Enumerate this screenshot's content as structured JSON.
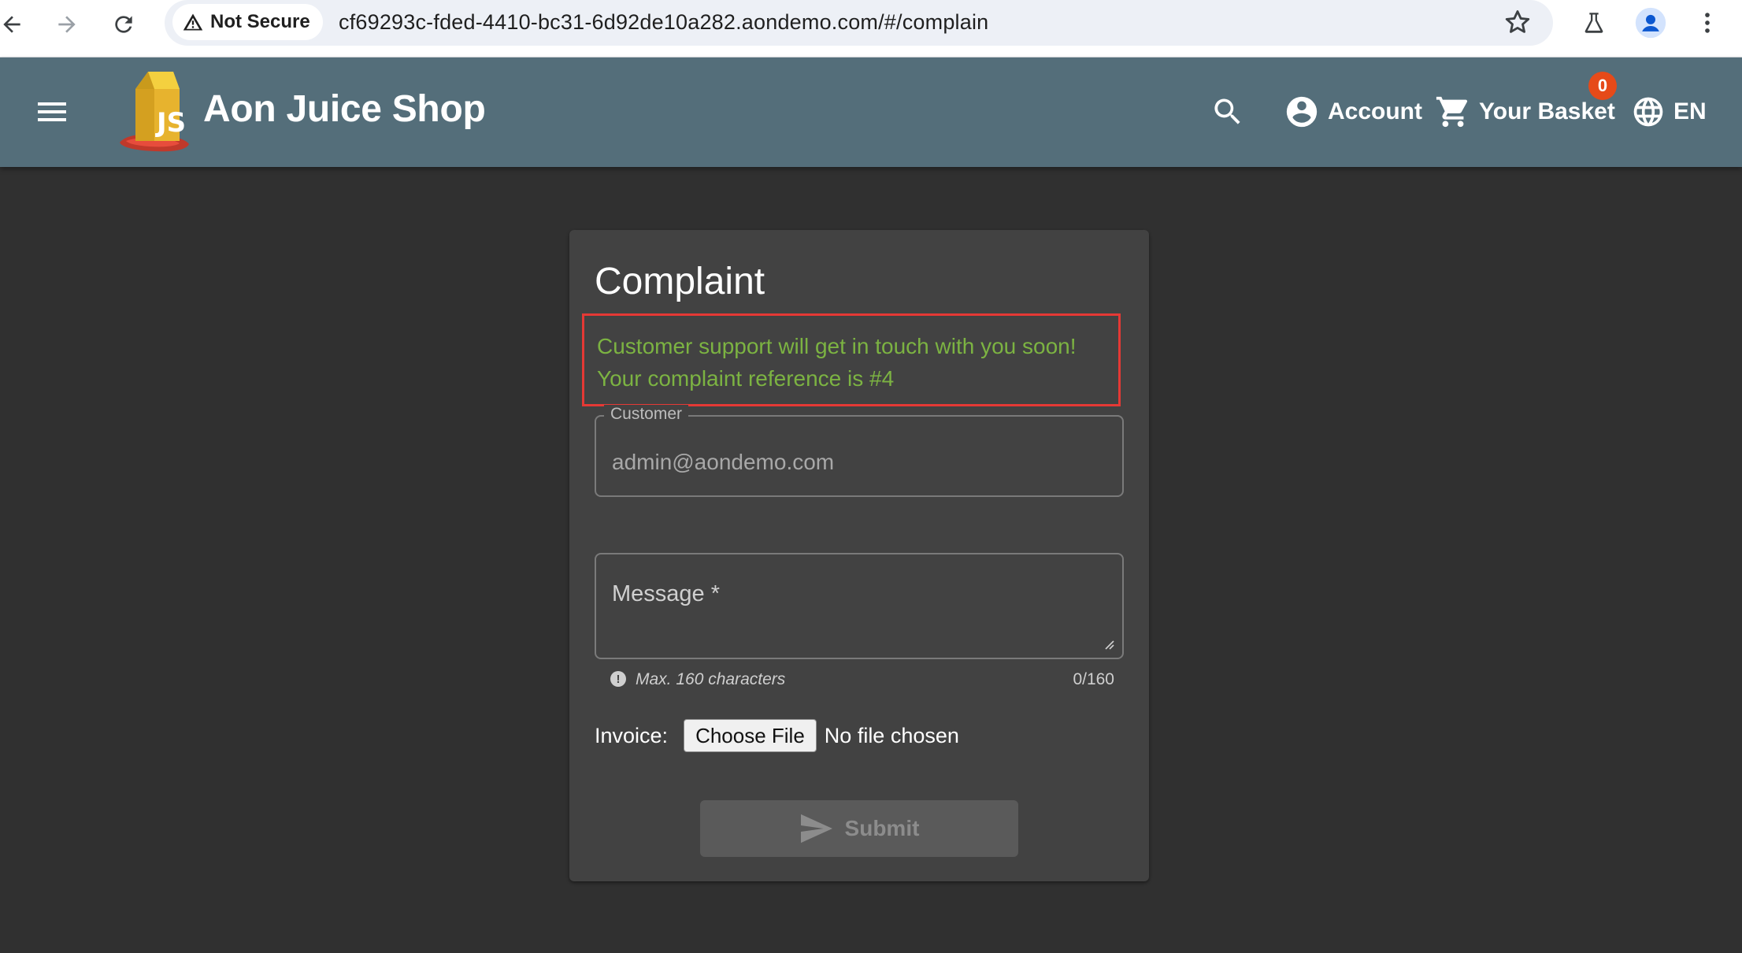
{
  "browser": {
    "security_label": "Not Secure",
    "url": "cf69293c-fded-4410-bc31-6d92de10a282.aondemo.com/#/complain"
  },
  "toolbar": {
    "app_title": "Aon Juice Shop",
    "account_label": "Account",
    "basket_label": "Your Basket",
    "basket_count": "0",
    "language_label": "EN",
    "background_color": "#546e7a"
  },
  "complaint": {
    "title": "Complaint",
    "confirmation_line1": "Customer support will get in touch with you soon!",
    "confirmation_line2": "Your complaint reference is #4",
    "customer_label": "Customer",
    "customer_value": "admin@aondemo.com",
    "message_label": "Message *",
    "message_hint": "Max. 160 characters",
    "message_count": "0/160",
    "invoice_label": "Invoice:",
    "choose_file_label": "Choose File",
    "no_file_label": "No file chosen",
    "submit_label": "Submit"
  },
  "colors": {
    "confirmation_text": "#7cb342",
    "highlight_border": "#e53935",
    "badge": "#e64a19",
    "page_background": "#303030",
    "card_background": "#424242"
  }
}
